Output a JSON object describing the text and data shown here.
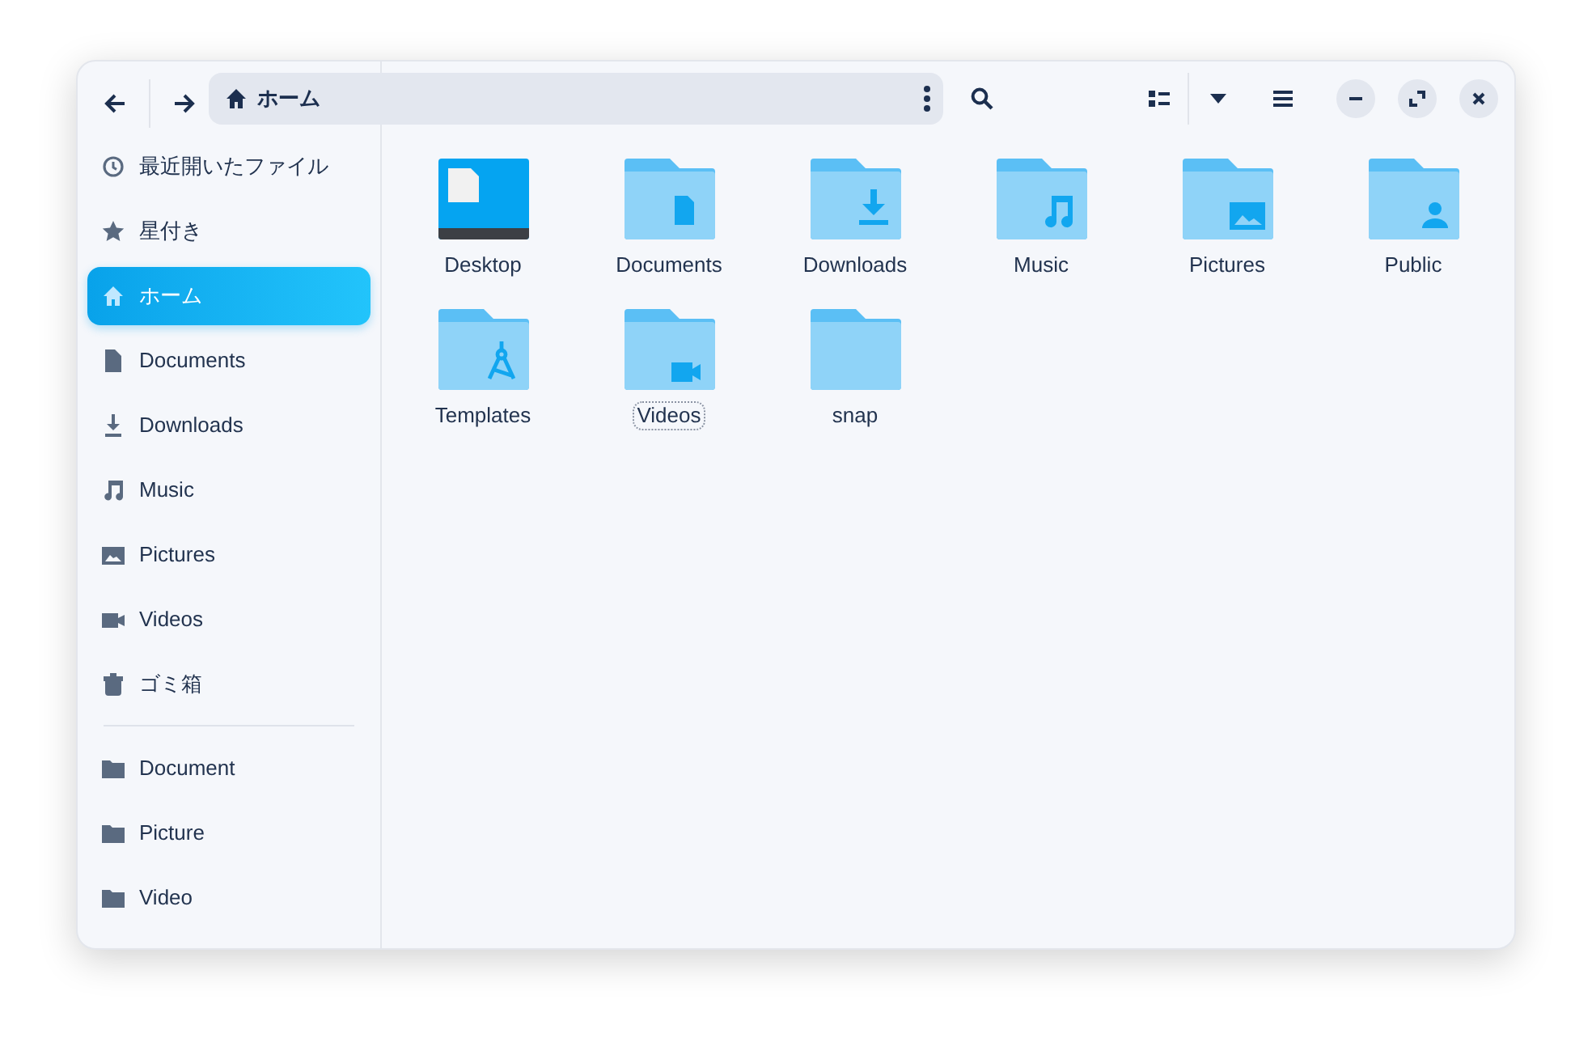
{
  "toolbar": {
    "location": "ホーム"
  },
  "sidebar": {
    "items": [
      {
        "label": "最近開いたファイル",
        "kind": "recent",
        "selected": false
      },
      {
        "label": "星付き",
        "kind": "starred",
        "selected": false
      },
      {
        "label": "ホーム",
        "kind": "home",
        "selected": true
      },
      {
        "label": "Documents",
        "kind": "document",
        "selected": false
      },
      {
        "label": "Downloads",
        "kind": "download",
        "selected": false
      },
      {
        "label": "Music",
        "kind": "music",
        "selected": false
      },
      {
        "label": "Pictures",
        "kind": "picture",
        "selected": false
      },
      {
        "label": "Videos",
        "kind": "video",
        "selected": false
      },
      {
        "label": "ゴミ箱",
        "kind": "trash",
        "selected": false
      }
    ],
    "bookmarks": [
      {
        "label": "Document",
        "kind": "folder",
        "selected": false
      },
      {
        "label": "Picture",
        "kind": "folder",
        "selected": false
      },
      {
        "label": "Video",
        "kind": "folder",
        "selected": false
      }
    ]
  },
  "files": [
    {
      "name": "Desktop",
      "kind": "desktop",
      "focused": false
    },
    {
      "name": "Documents",
      "kind": "document",
      "focused": false
    },
    {
      "name": "Downloads",
      "kind": "download",
      "focused": false
    },
    {
      "name": "Music",
      "kind": "music",
      "focused": false
    },
    {
      "name": "Pictures",
      "kind": "picture",
      "focused": false
    },
    {
      "name": "Public",
      "kind": "public",
      "focused": false
    },
    {
      "name": "Templates",
      "kind": "template",
      "focused": false
    },
    {
      "name": "Videos",
      "kind": "video",
      "focused": true
    },
    {
      "name": "snap",
      "kind": "plain",
      "focused": false
    }
  ]
}
